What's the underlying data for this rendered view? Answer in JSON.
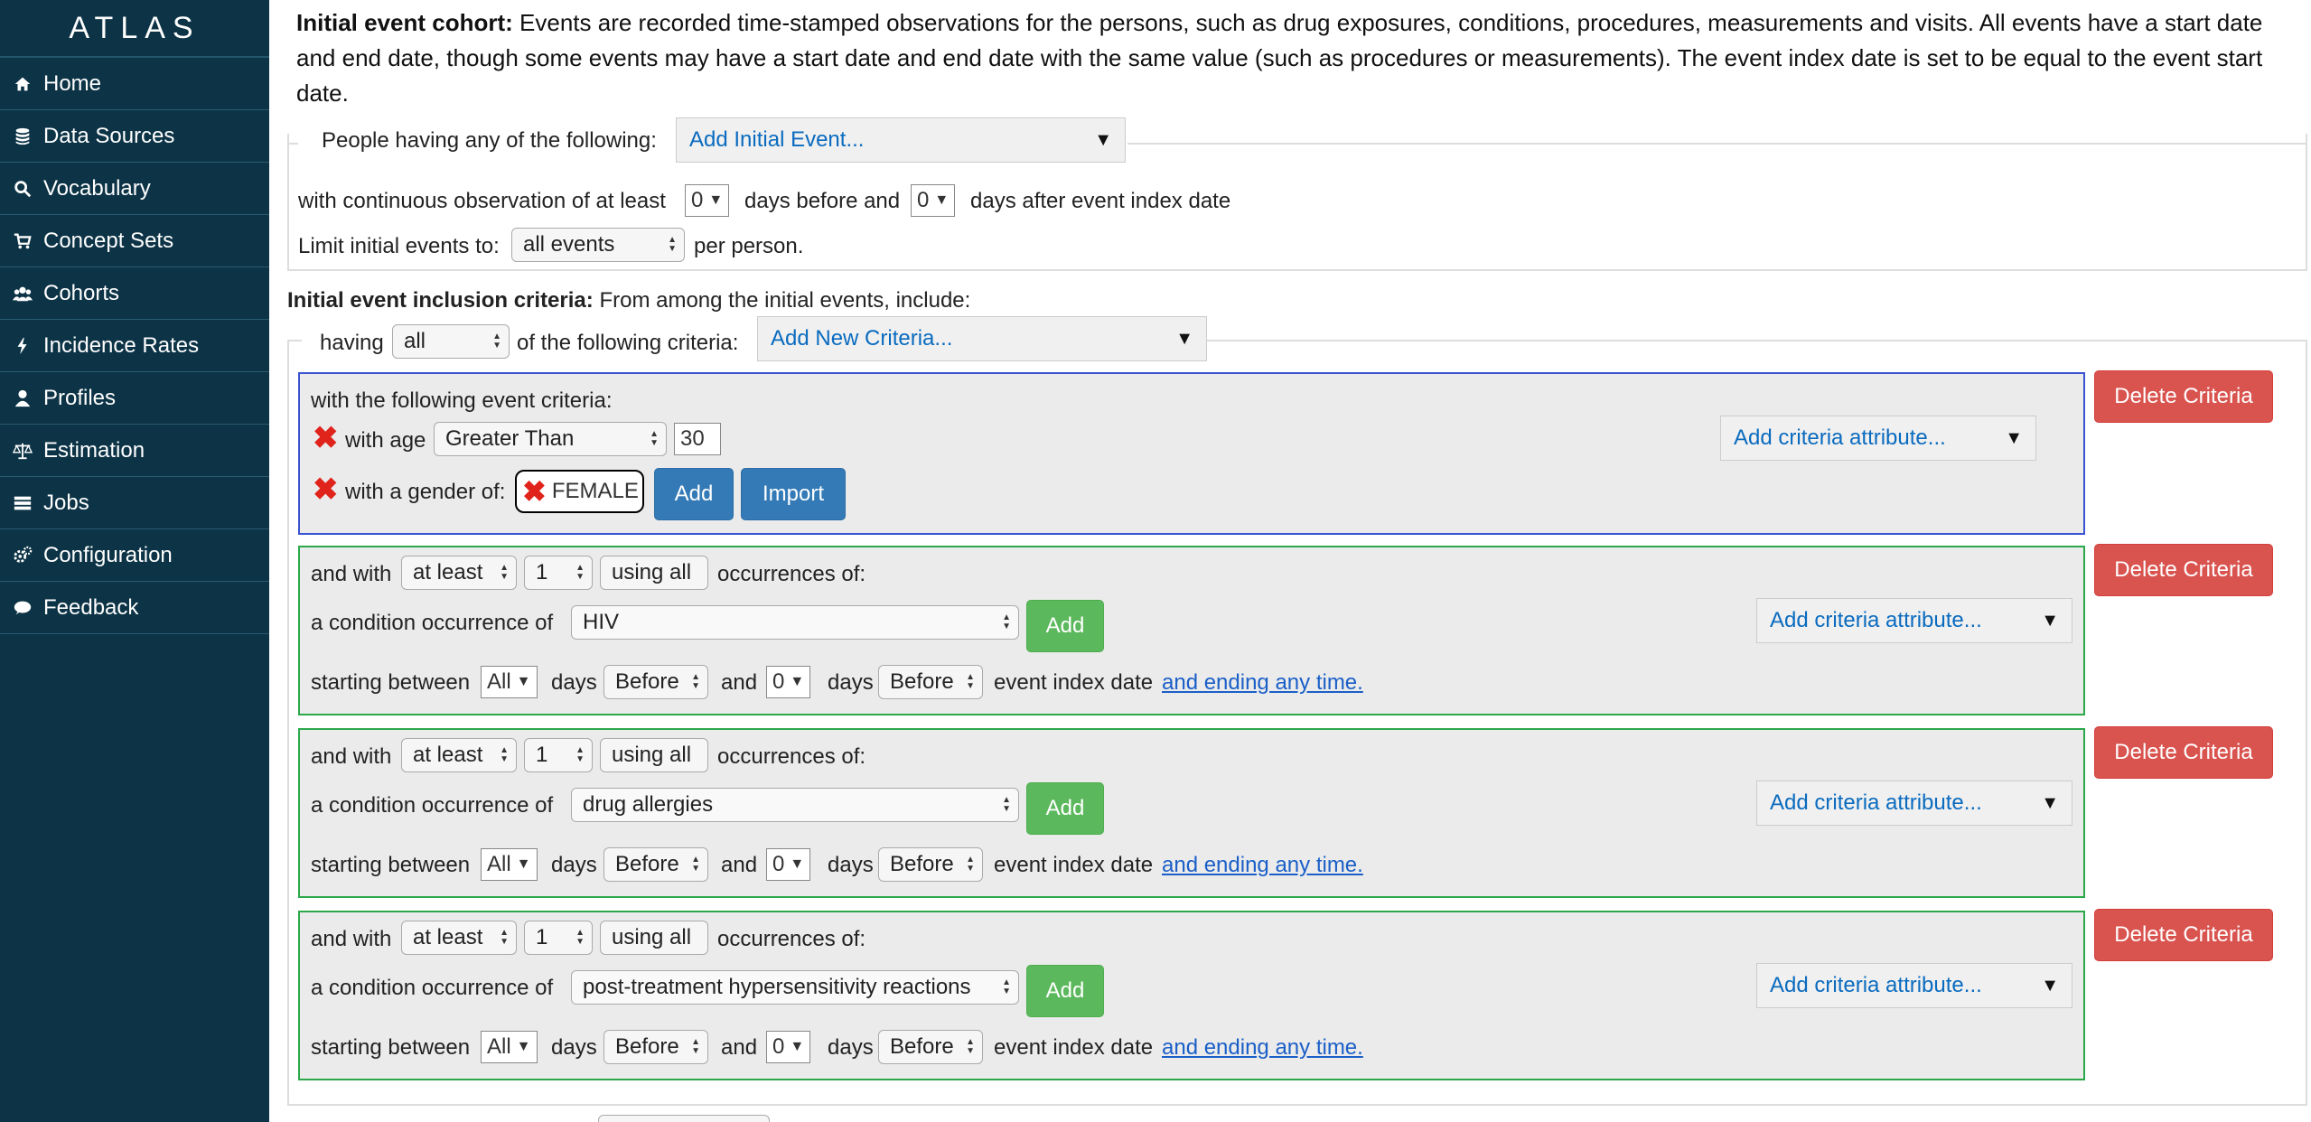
{
  "app": {
    "brand": "ATLAS",
    "nav": [
      {
        "label": "Home",
        "icon": "home-icon"
      },
      {
        "label": "Data Sources",
        "icon": "database-icon"
      },
      {
        "label": "Vocabulary",
        "icon": "search-icon"
      },
      {
        "label": "Concept Sets",
        "icon": "cart-icon"
      },
      {
        "label": "Cohorts",
        "icon": "users-icon"
      },
      {
        "label": "Incidence Rates",
        "icon": "bolt-icon"
      },
      {
        "label": "Profiles",
        "icon": "user-icon"
      },
      {
        "label": "Estimation",
        "icon": "balance-scale-icon"
      },
      {
        "label": "Jobs",
        "icon": "tasks-icon"
      },
      {
        "label": "Configuration",
        "icon": "cogs-icon"
      },
      {
        "label": "Feedback",
        "icon": "comment-icon"
      }
    ],
    "colors": {
      "sidebar": "#0c3346",
      "link": "#0a6bbf",
      "danger": "#d9534f",
      "success": "#5cb85c",
      "primary": "#337ab7"
    }
  },
  "initial_event": {
    "title": "Initial event cohort:",
    "description": "Events are recorded time-stamped observations for the persons, such as drug exposures, conditions, procedures, measurements and visits. All events have a start date and end date, though some events may have a start date and end date with the same value (such as procedures or measurements). The event index date is set to be equal to the event start date.",
    "people_having": "People having any of the following:",
    "add_initial_event": "Add Initial Event...",
    "obs_prefix": "with continuous observation of at least",
    "obs_before_value": "0",
    "obs_mid": "days before and",
    "obs_after_value": "0",
    "obs_suffix": "days after event index date",
    "limit_prefix": "Limit initial events to:",
    "limit_value": "all events",
    "limit_suffix": "per person."
  },
  "inclusion": {
    "title": "Initial event inclusion criteria:",
    "subtitle": "From among the initial events, include:",
    "having": "having",
    "having_value": "all",
    "of_following": "of the following criteria:",
    "add_new_criteria": "Add New Criteria..."
  },
  "event_criteria": {
    "heading": "with the following event criteria:",
    "age_label": "with age",
    "age_op": "Greater Than",
    "age_value": "30",
    "gender_label": "with a gender of:",
    "gender_token": "FEMALE",
    "add": "Add",
    "import": "Import",
    "add_attr": "Add criteria attribute...",
    "delete": "Delete Criteria"
  },
  "criteria": [
    {
      "and_with": "and with",
      "count_op": "at least",
      "count": "1",
      "using": "using all",
      "occ": "occurrences of:",
      "cond_label": "a condition occurrence of",
      "concept": "HIV",
      "add": "Add",
      "start_label": "starting between",
      "days1": "All",
      "days_word1": "days",
      "before1": "Before",
      "and_word": "and",
      "days2": "0",
      "days_word2": "days",
      "before2": "Before",
      "index_label": "event index date",
      "ending": "and ending any time.",
      "add_attr": "Add criteria attribute...",
      "delete": "Delete Criteria"
    },
    {
      "and_with": "and with",
      "count_op": "at least",
      "count": "1",
      "using": "using all",
      "occ": "occurrences of:",
      "cond_label": "a condition occurrence of",
      "concept": "drug allergies",
      "add": "Add",
      "start_label": "starting between",
      "days1": "All",
      "days_word1": "days",
      "before1": "Before",
      "and_word": "and",
      "days2": "0",
      "days_word2": "days",
      "before2": "Before",
      "index_label": "event index date",
      "ending": "and ending any time.",
      "add_attr": "Add criteria attribute...",
      "delete": "Delete Criteria"
    },
    {
      "and_with": "and with",
      "count_op": "at least",
      "count": "1",
      "using": "using all",
      "occ": "occurrences of:",
      "cond_label": "a condition occurrence of",
      "concept": "post-treatment hypersensitivity reactions",
      "add": "Add",
      "start_label": "starting between",
      "days1": "All",
      "days_word1": "days",
      "before1": "Before",
      "and_word": "and",
      "days2": "0",
      "days_word2": "days",
      "before2": "Before",
      "index_label": "event index date",
      "ending": "and ending any time.",
      "add_attr": "Add criteria attribute...",
      "delete": "Delete Criteria"
    }
  ]
}
